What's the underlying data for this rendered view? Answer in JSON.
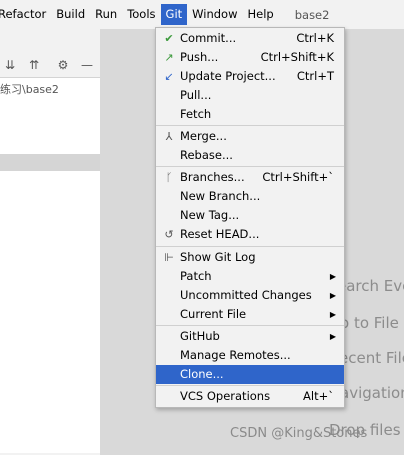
{
  "menubar": {
    "items": [
      "Refactor",
      "Build",
      "Run",
      "Tools",
      "Git",
      "Window",
      "Help"
    ],
    "project_name": "base2"
  },
  "project_panel": {
    "path_text": "练习\\base2"
  },
  "git_menu": {
    "commit": {
      "label": "Commit...",
      "shortcut": "Ctrl+K",
      "icon": "check-icon"
    },
    "push": {
      "label": "Push...",
      "shortcut": "Ctrl+Shift+K",
      "icon": "push-arrow-icon"
    },
    "update": {
      "label": "Update Project...",
      "shortcut": "Ctrl+T",
      "icon": "update-arrow-icon"
    },
    "pull": {
      "label": "Pull..."
    },
    "fetch": {
      "label": "Fetch"
    },
    "merge": {
      "label": "Merge...",
      "icon": "merge-icon"
    },
    "rebase": {
      "label": "Rebase..."
    },
    "branches": {
      "label": "Branches...",
      "shortcut": "Ctrl+Shift+`",
      "icon": "branch-icon"
    },
    "new_branch": {
      "label": "New Branch..."
    },
    "new_tag": {
      "label": "New Tag..."
    },
    "reset_head": {
      "label": "Reset HEAD...",
      "icon": "reset-icon"
    },
    "show_log": {
      "label": "Show Git Log",
      "icon": "git-log-icon"
    },
    "patch": {
      "label": "Patch"
    },
    "uncommitted": {
      "label": "Uncommitted Changes"
    },
    "current_file": {
      "label": "Current File"
    },
    "github": {
      "label": "GitHub"
    },
    "manage_remotes": {
      "label": "Manage Remotes..."
    },
    "clone": {
      "label": "Clone..."
    },
    "vcs_operations": {
      "label": "VCS Operations",
      "shortcut": "Alt+`"
    }
  },
  "editor_hints": {
    "search": "earch Eve",
    "goto": "o to File",
    "recent": "ecent File",
    "navigation": "avigation",
    "drop": "Drop files h"
  },
  "watermark": "CSDN @King&Stones",
  "colors": {
    "accent": "#2f65ca",
    "menu_bg": "#f2f2f2",
    "editor_bg": "#d9d9d9"
  }
}
